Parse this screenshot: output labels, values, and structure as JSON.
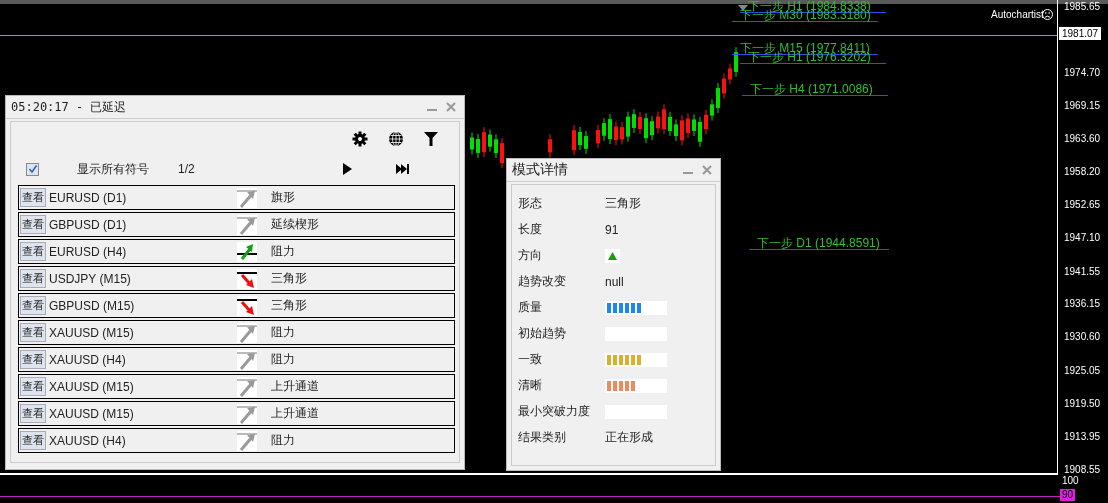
{
  "chart": {
    "brand": "Autochartist",
    "current_price": "1981.07",
    "price_axis": [
      "1985.65",
      "1974.70",
      "1969.15",
      "1963.60",
      "1958.20",
      "1952.65",
      "1947.10",
      "1941.55",
      "1936.15",
      "1930.60",
      "1925.05",
      "1919.50",
      "1913.95",
      "1908.55"
    ],
    "forecasts": [
      {
        "text": "下一步 H1 (1984.8338)"
      },
      {
        "text": "下一步 M30 (1983.3180)"
      },
      {
        "text": "下一步 M15 (1977.8411)"
      },
      {
        "text": "下一步 H1 (1976.3202)"
      },
      {
        "text": "下一步 H4 (1971.0086)"
      },
      {
        "text": "下一步 D1 (1944.8591)"
      }
    ],
    "indicator_axis": [
      "100",
      "90"
    ]
  },
  "scanner": {
    "title": "05:20:17 - 已延迟",
    "show_all": {
      "label": "显示所有符号",
      "checked": true
    },
    "page": "1/2",
    "rows": [
      {
        "button": "查看",
        "symbol": "EURUSD (D1)",
        "kind": "neutral",
        "pattern": "旗形"
      },
      {
        "button": "查看",
        "symbol": "GBPUSD (D1)",
        "kind": "neutral",
        "pattern": "延续楔形"
      },
      {
        "button": "查看",
        "symbol": "EURUSD (H4)",
        "kind": "up",
        "pattern": "阻力"
      },
      {
        "button": "查看",
        "symbol": "USDJPY (M15)",
        "kind": "down",
        "pattern": "三角形"
      },
      {
        "button": "查看",
        "symbol": "GBPUSD (M15)",
        "kind": "down",
        "pattern": "三角形"
      },
      {
        "button": "查看",
        "symbol": "XAUUSD (M15)",
        "kind": "neutral",
        "pattern": "阻力"
      },
      {
        "button": "查看",
        "symbol": "XAUUSD (H4)",
        "kind": "neutral",
        "pattern": "阻力"
      },
      {
        "button": "查看",
        "symbol": "XAUUSD (M15)",
        "kind": "neutral",
        "pattern": "上升通道"
      },
      {
        "button": "查看",
        "symbol": "XAUUSD (M15)",
        "kind": "neutral",
        "pattern": "上升通道"
      },
      {
        "button": "查看",
        "symbol": "XAUUSD (H4)",
        "kind": "neutral",
        "pattern": "阻力"
      }
    ]
  },
  "details": {
    "title": "模式详情",
    "fields": [
      {
        "label": "形态",
        "kind": "text",
        "value": "三角形"
      },
      {
        "label": "长度",
        "kind": "text",
        "value": "91"
      },
      {
        "label": "方向",
        "kind": "arrow_up"
      },
      {
        "label": "趋势改变",
        "kind": "text",
        "value": "null"
      },
      {
        "label": "质量",
        "kind": "meter",
        "level": 0.6,
        "color": "#1e88f0"
      },
      {
        "label": "初始趋势",
        "kind": "empty"
      },
      {
        "label": "一致",
        "kind": "meter",
        "level": 0.6,
        "color": "#d8b030"
      },
      {
        "label": "清晰",
        "kind": "meter",
        "level": 0.5,
        "color": "#f08860"
      },
      {
        "label": "最小突破力度",
        "kind": "empty"
      },
      {
        "label": "结果类别",
        "kind": "text",
        "value": "正在形成"
      }
    ]
  }
}
